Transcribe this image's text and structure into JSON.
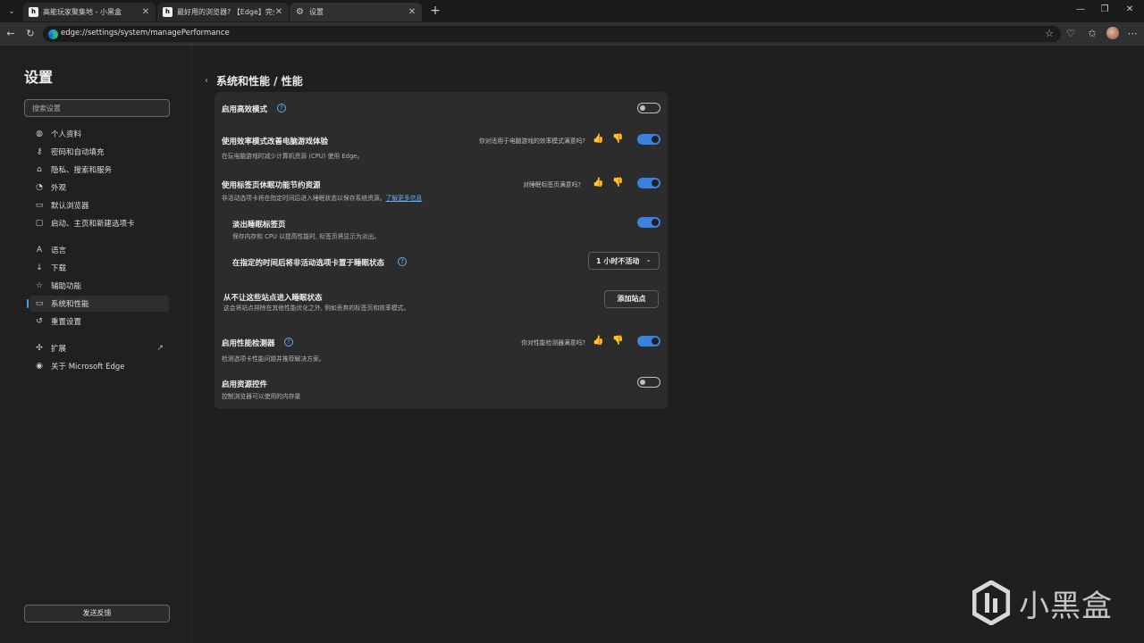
{
  "tabs": [
    {
      "title": "高能玩家聚集地 - 小黑盒",
      "favicon": "h"
    },
    {
      "title": "最好用的浏览器? 【Edge】完全体",
      "favicon": "h"
    },
    {
      "title": "设置",
      "favicon": "gear-icon"
    }
  ],
  "toolbar": {
    "url": "edge://settings/system/managePerformance"
  },
  "sidebar": {
    "title": "设置",
    "search_placeholder": "搜索设置",
    "items": [
      {
        "label": "个人资料",
        "icon": "profile-icon"
      },
      {
        "label": "密码和自动填充",
        "icon": "key-icon"
      },
      {
        "label": "隐私、搜索和服务",
        "icon": "lock-icon"
      },
      {
        "label": "外观",
        "icon": "appearance-icon"
      },
      {
        "label": "默认浏览器",
        "icon": "browser-icon"
      },
      {
        "label": "启动、主页和新建选项卡",
        "icon": "start-icon"
      },
      {
        "label": "语言",
        "icon": "language-icon"
      },
      {
        "label": "下载",
        "icon": "download-icon"
      },
      {
        "label": "辅助功能",
        "icon": "accessibility-icon"
      },
      {
        "label": "系统和性能",
        "icon": "laptop-icon",
        "selected": true
      },
      {
        "label": "重置设置",
        "icon": "reset-icon"
      },
      {
        "label": "扩展",
        "icon": "extension-icon"
      },
      {
        "label": "关于 Microsoft Edge",
        "icon": "edge-icon"
      }
    ],
    "feedback_label": "发送反馈"
  },
  "main": {
    "breadcrumb": "系统和性能 / 性能",
    "settings": {
      "efficiency_mode": {
        "title": "启用高效模式",
        "enabled": false
      },
      "gaming": {
        "title": "使用效率模式改善电脑游戏体验",
        "desc": "在玩电脑游戏时减少计算机资源 (CPU) 使用 Edge。",
        "question": "你对适用于电脑游戏的效率模式满意吗?",
        "enabled": true
      },
      "sleeping_tabs": {
        "title": "使用标签页休眠功能节约资源",
        "desc": "非活动选项卡将在指定时间后进入睡眠状态以保存系统资源。",
        "link": "了解更多信息",
        "question": "对睡眠标签页满意吗?",
        "enabled": true
      },
      "fade_tabs": {
        "title": "淡出睡眠标签页",
        "desc": "保存内存和 CPU 以提高性能时, 标签页将显示为淡出。",
        "enabled": true
      },
      "sleep_after": {
        "title": "在指定的时间后将非活动选项卡置于睡眠状态",
        "value": "1 小时不活动"
      },
      "never_sleep": {
        "title": "从不让这些站点进入睡眠状态",
        "desc": "这会将站点排除在其他性能优化之外, 例如丢弃的标签页和效率模式。",
        "button": "添加站点"
      },
      "detector": {
        "title": "启用性能检测器",
        "desc": "检测选项卡性能问题并推荐解决方案。",
        "question": "你对性能检测器满意吗?",
        "enabled": true
      },
      "resource_controls": {
        "title": "启用资源控件",
        "desc": "控制浏览器可以使用的内存量",
        "enabled": false
      }
    }
  },
  "watermark": {
    "text": "小黑盒"
  },
  "colors": {
    "accent": "#3a82e0",
    "link": "#6aacf2",
    "panel": "#2c2c2c"
  }
}
